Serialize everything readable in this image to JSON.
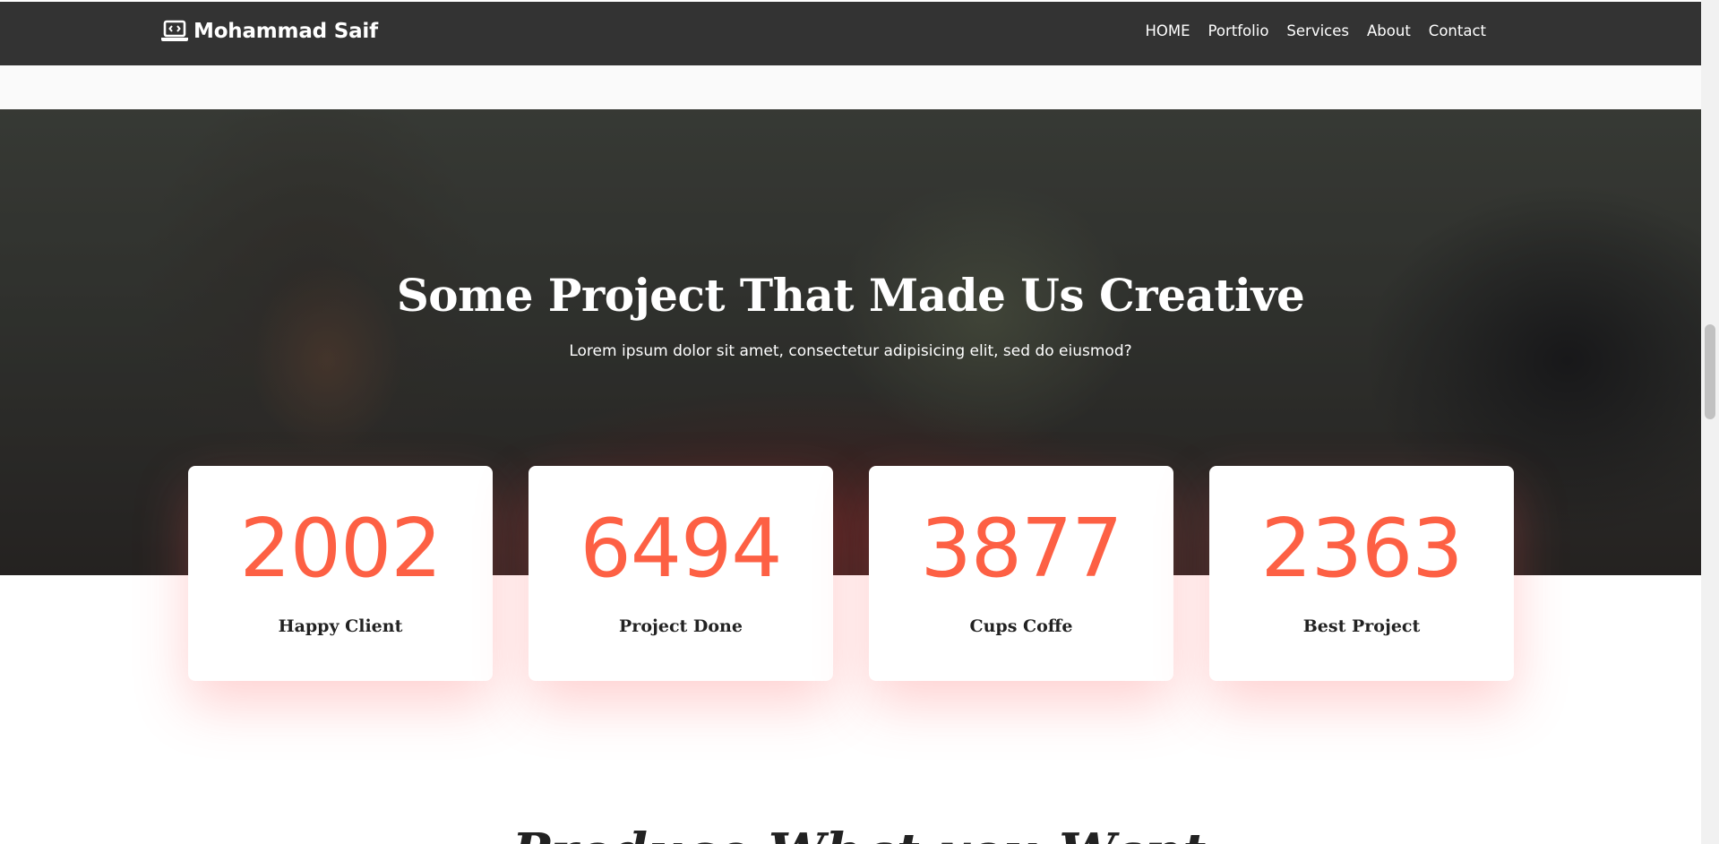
{
  "navbar": {
    "brand": {
      "icon": "laptop-code-icon",
      "name": "Mohammad Saif"
    },
    "links": [
      {
        "label": "HOME"
      },
      {
        "label": "Portfolio"
      },
      {
        "label": "Services"
      },
      {
        "label": "About"
      },
      {
        "label": "Contact"
      }
    ]
  },
  "hero": {
    "title": "Some Project That Made Us Creative",
    "subtitle": "Lorem ipsum dolor sit amet, consectetur adipisicing elit, sed do eiusmod?"
  },
  "stats": [
    {
      "number": "2002",
      "label": "Happy Client"
    },
    {
      "number": "6494",
      "label": "Project Done"
    },
    {
      "number": "3877",
      "label": "Cups Coffe"
    },
    {
      "number": "2363",
      "label": "Best Project"
    }
  ],
  "next_section": {
    "title": "Produce What you Want"
  },
  "colors": {
    "navbar_bg": "#333333",
    "accent": "#fd6044",
    "heading_dark": "#222222"
  }
}
